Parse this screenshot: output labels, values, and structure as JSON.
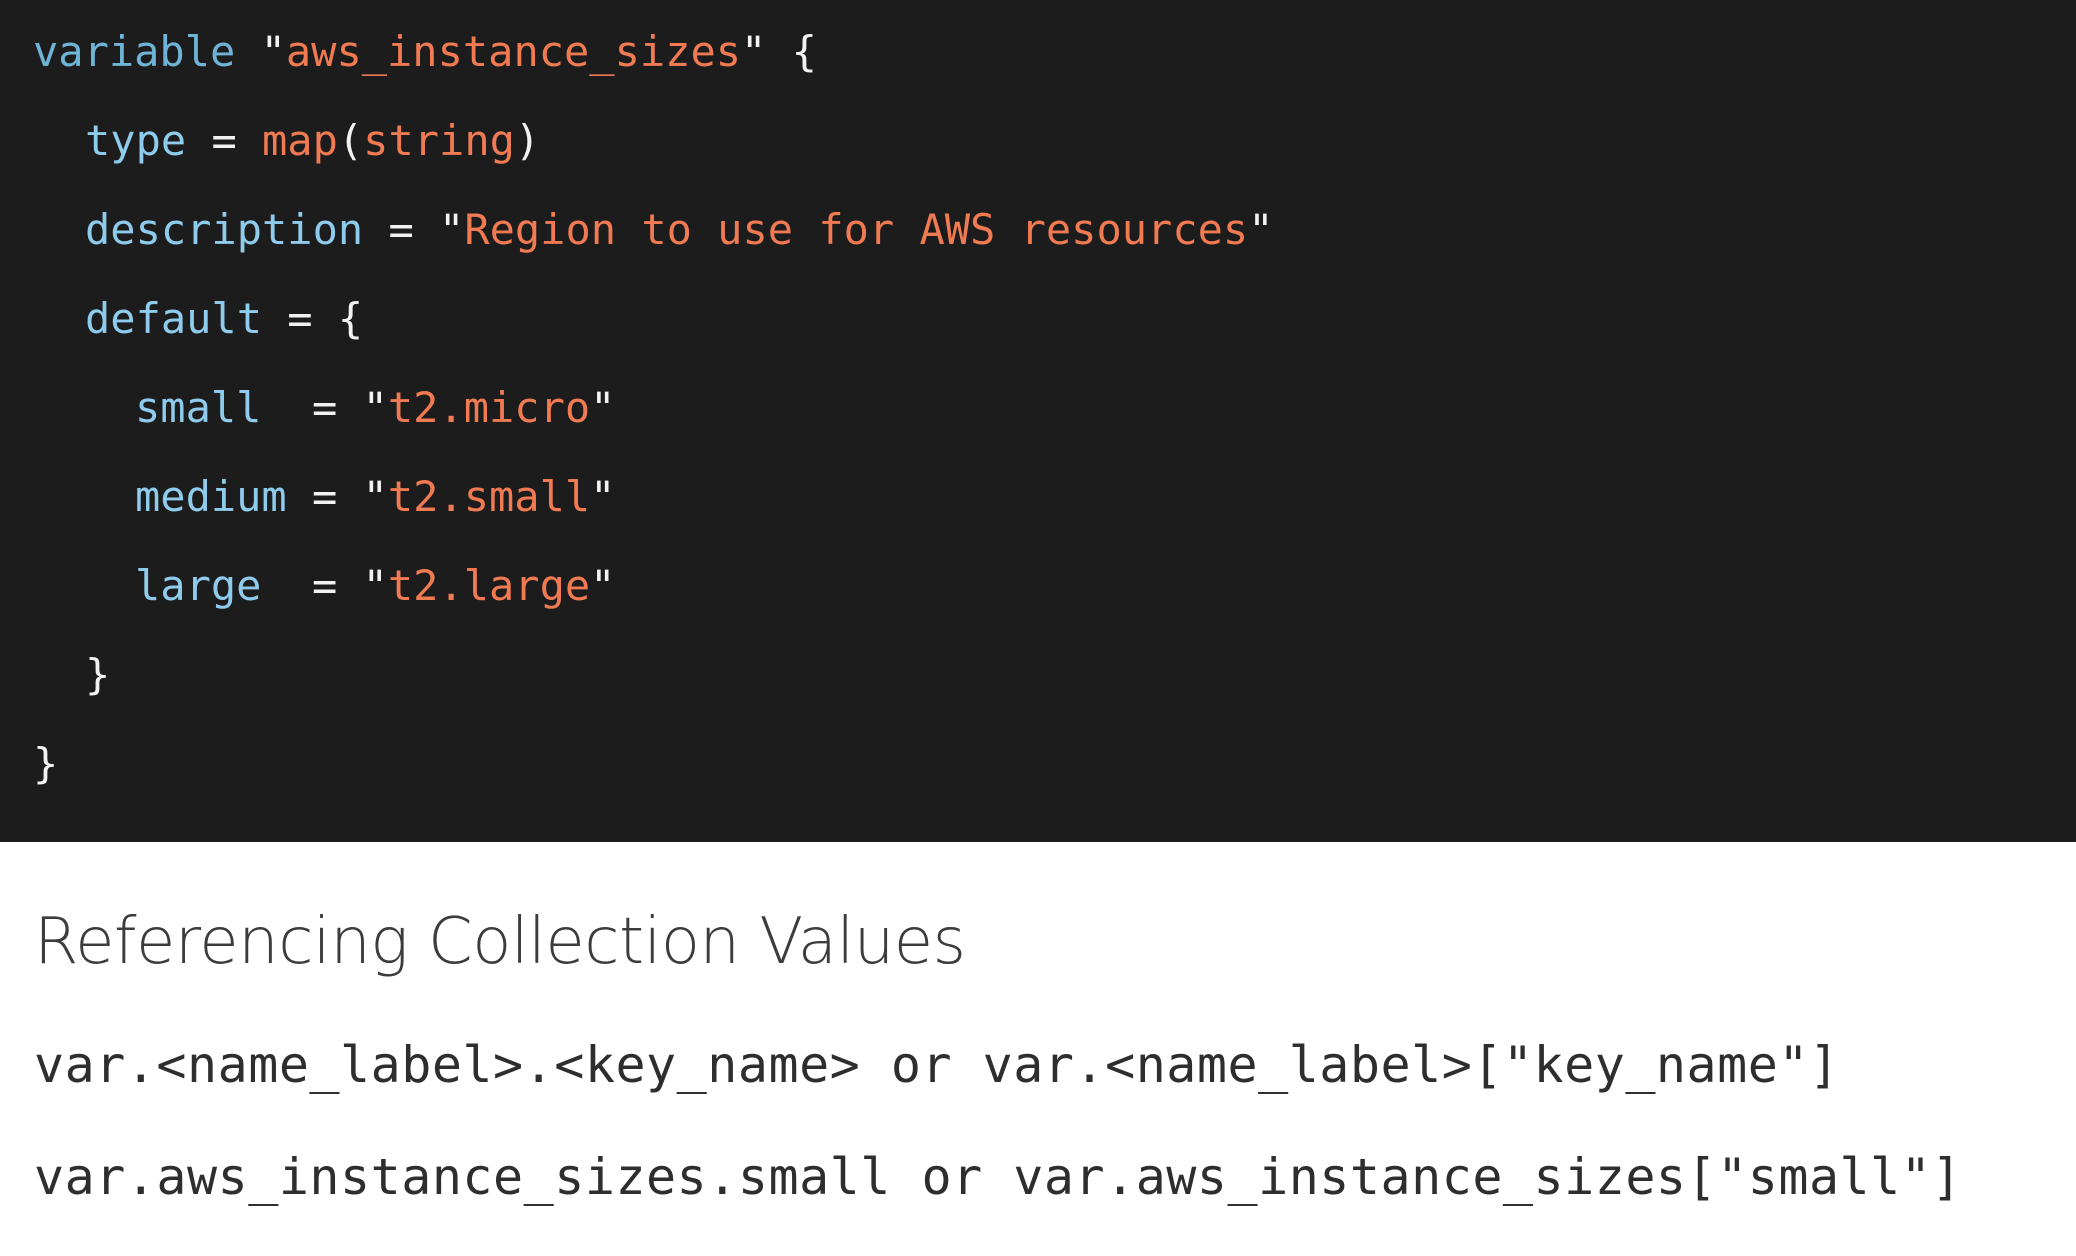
{
  "code": {
    "line1": {
      "keyword": "variable",
      "q1": " \"",
      "name": "aws_instance_sizes",
      "q2": "\" {"
    },
    "line2": {
      "attr": "type",
      "eq": " = ",
      "fn": "map",
      "open": "(",
      "arg": "string",
      "close": ")"
    },
    "line3": {
      "attr": "description",
      "eq": " = \"",
      "value": "Region to use for AWS resources",
      "close": "\""
    },
    "line4": {
      "attr": "default",
      "rest": " = {"
    },
    "line5": {
      "key": "small ",
      "eq": " = \"",
      "value": "t2.micro",
      "close": "\""
    },
    "line6": {
      "key": "medium",
      "eq": " = \"",
      "value": "t2.small",
      "close": "\""
    },
    "line7": {
      "key": "large ",
      "eq": " = \"",
      "value": "t2.large",
      "close": "\""
    },
    "line8": "}",
    "line9": "}"
  },
  "section": {
    "title": "Referencing Collection Values",
    "syntax_line": "var.<name_label>.<key_name> or var.<name_label>[\"key_name\"]",
    "example_line": "var.aws_instance_sizes.small or var.aws_instance_sizes[\"small\"]"
  },
  "colors": {
    "code_background": "#1c1c1c",
    "keyword": "#6fb4d6",
    "string": "#f07a52",
    "page_background": "#ffffff"
  }
}
